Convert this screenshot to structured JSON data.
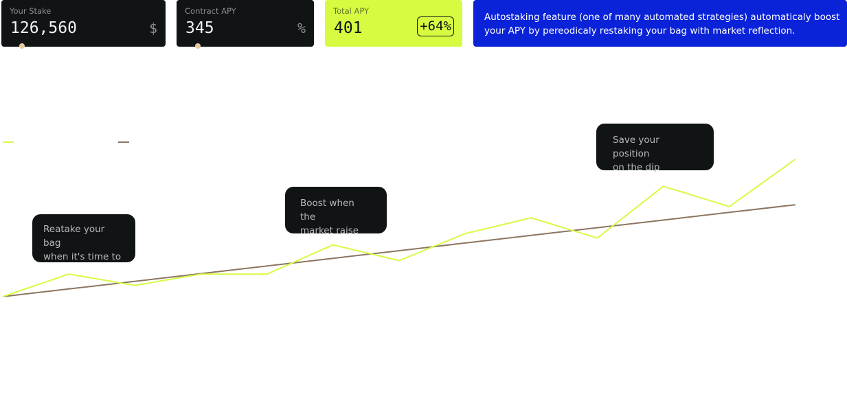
{
  "stake_card": {
    "label": "Your Stake",
    "value": "126,560",
    "unit": "$",
    "slider_level": 0.03
  },
  "contract_card": {
    "label": "Contract APY",
    "value": "345",
    "unit": "%",
    "slider_level": 0.03
  },
  "total_card": {
    "label": "Total APY",
    "value": "401",
    "badge": "+64%"
  },
  "info": {
    "text": "Autostaking feature (one of many automated strategies) automaticaly boost your APY by pereodicaly restaking your bag with market reflection."
  },
  "tooltips": {
    "restake": {
      "line1": "Reatake your bag",
      "line2": "when it's time to"
    },
    "boost": {
      "line1": "Boost when the",
      "line2": "market raise"
    },
    "dip": {
      "line1": "Save your position",
      "line2": "on the dip"
    }
  },
  "colors": {
    "dark": "#101415",
    "lime": "#d6fb41",
    "blue": "#0a23d8",
    "knob": "#e9c9a1",
    "autostake_line": "#d6fb41",
    "contract_line": "#8b7560"
  },
  "chart_data": {
    "type": "line",
    "x": [
      0,
      1,
      2,
      3,
      4,
      5,
      6,
      7,
      8,
      9,
      10,
      11,
      12
    ],
    "series": [
      {
        "color": "#d6fb41",
        "values": [
          0,
          1.0,
          0.5,
          1.0,
          1.0,
          2.3,
          1.6,
          2.8,
          3.5,
          2.6,
          4.9,
          4.0,
          6.1
        ]
      },
      {
        "color": "#8b7560",
        "values": [
          0,
          0.34,
          0.68,
          1.02,
          1.36,
          1.7,
          2.04,
          2.38,
          2.72,
          3.06,
          3.4,
          3.74,
          4.08
        ]
      }
    ],
    "legend": "top-left",
    "grid": false
  }
}
